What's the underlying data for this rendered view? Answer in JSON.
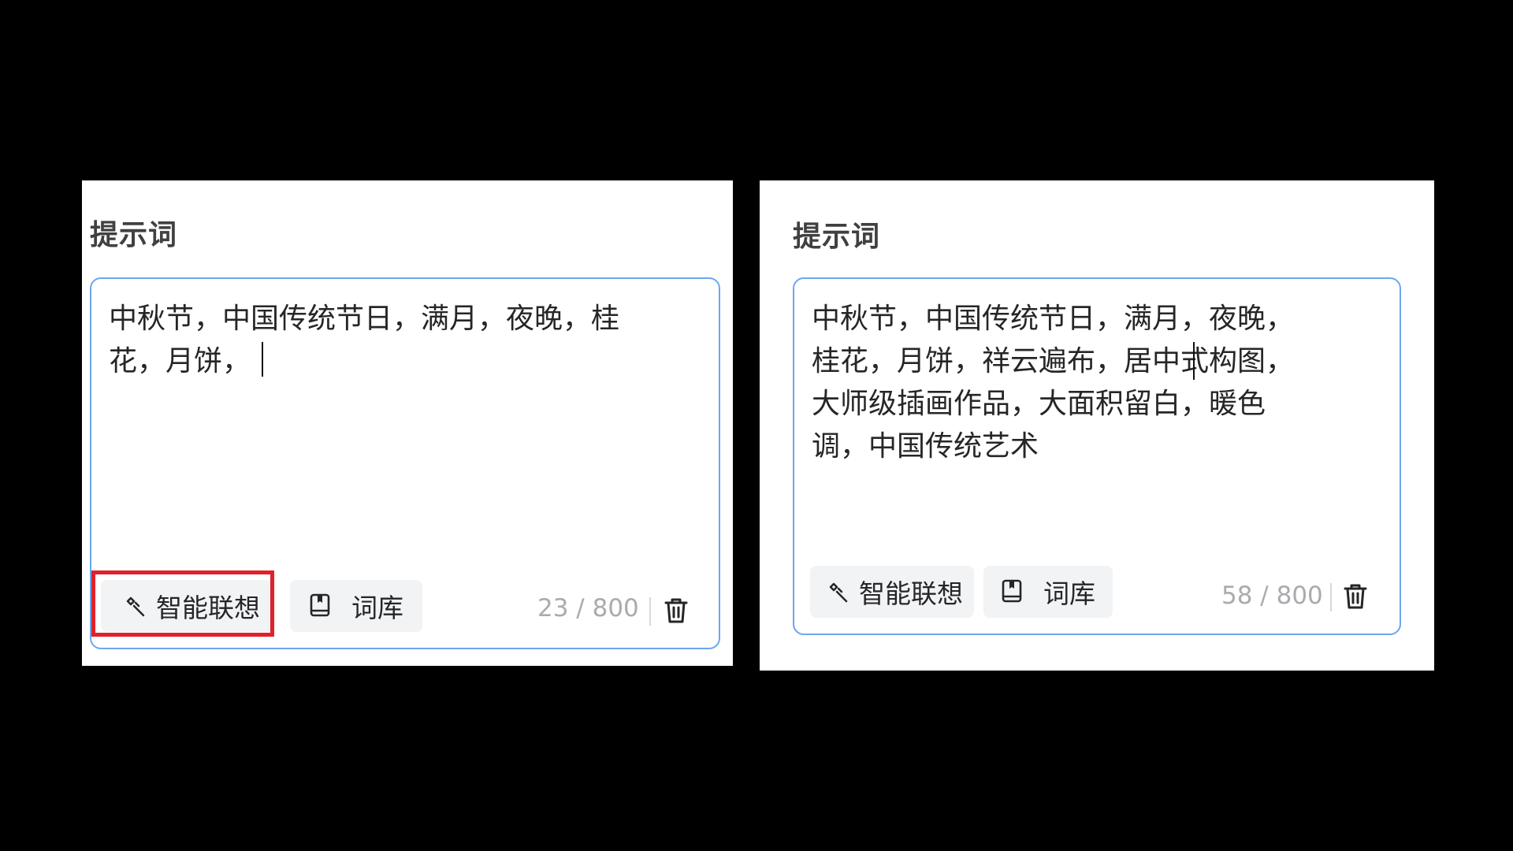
{
  "panels": [
    {
      "title": "提示词",
      "prompt_text": "中秋节，中国传统节日，满月，夜晚，桂花，月饼，",
      "buttons": {
        "smart_assoc": "智能联想",
        "library": "词库"
      },
      "counter": "23 / 800",
      "highlighted": "智能联想"
    },
    {
      "title": "提示词",
      "prompt_text": "中秋节，中国传统节日，满月，夜晚，桂花，月饼，祥云遍布，居中式构图，大师级插画作品，大面积留白，暖色调，中国传统艺术",
      "buttons": {
        "smart_assoc": "智能联想",
        "library": "词库"
      },
      "counter": "58 / 800"
    }
  ],
  "icons": {
    "smart_assoc": "sparkle-wand-icon",
    "library": "book-icon",
    "clear": "trash-icon"
  },
  "colors": {
    "background": "#000000",
    "panel": "#ffffff",
    "input_border": "#6aa8ef",
    "button_bg": "#f2f3f5",
    "highlight": "#e0202a",
    "counter_text": "#a9abae"
  }
}
